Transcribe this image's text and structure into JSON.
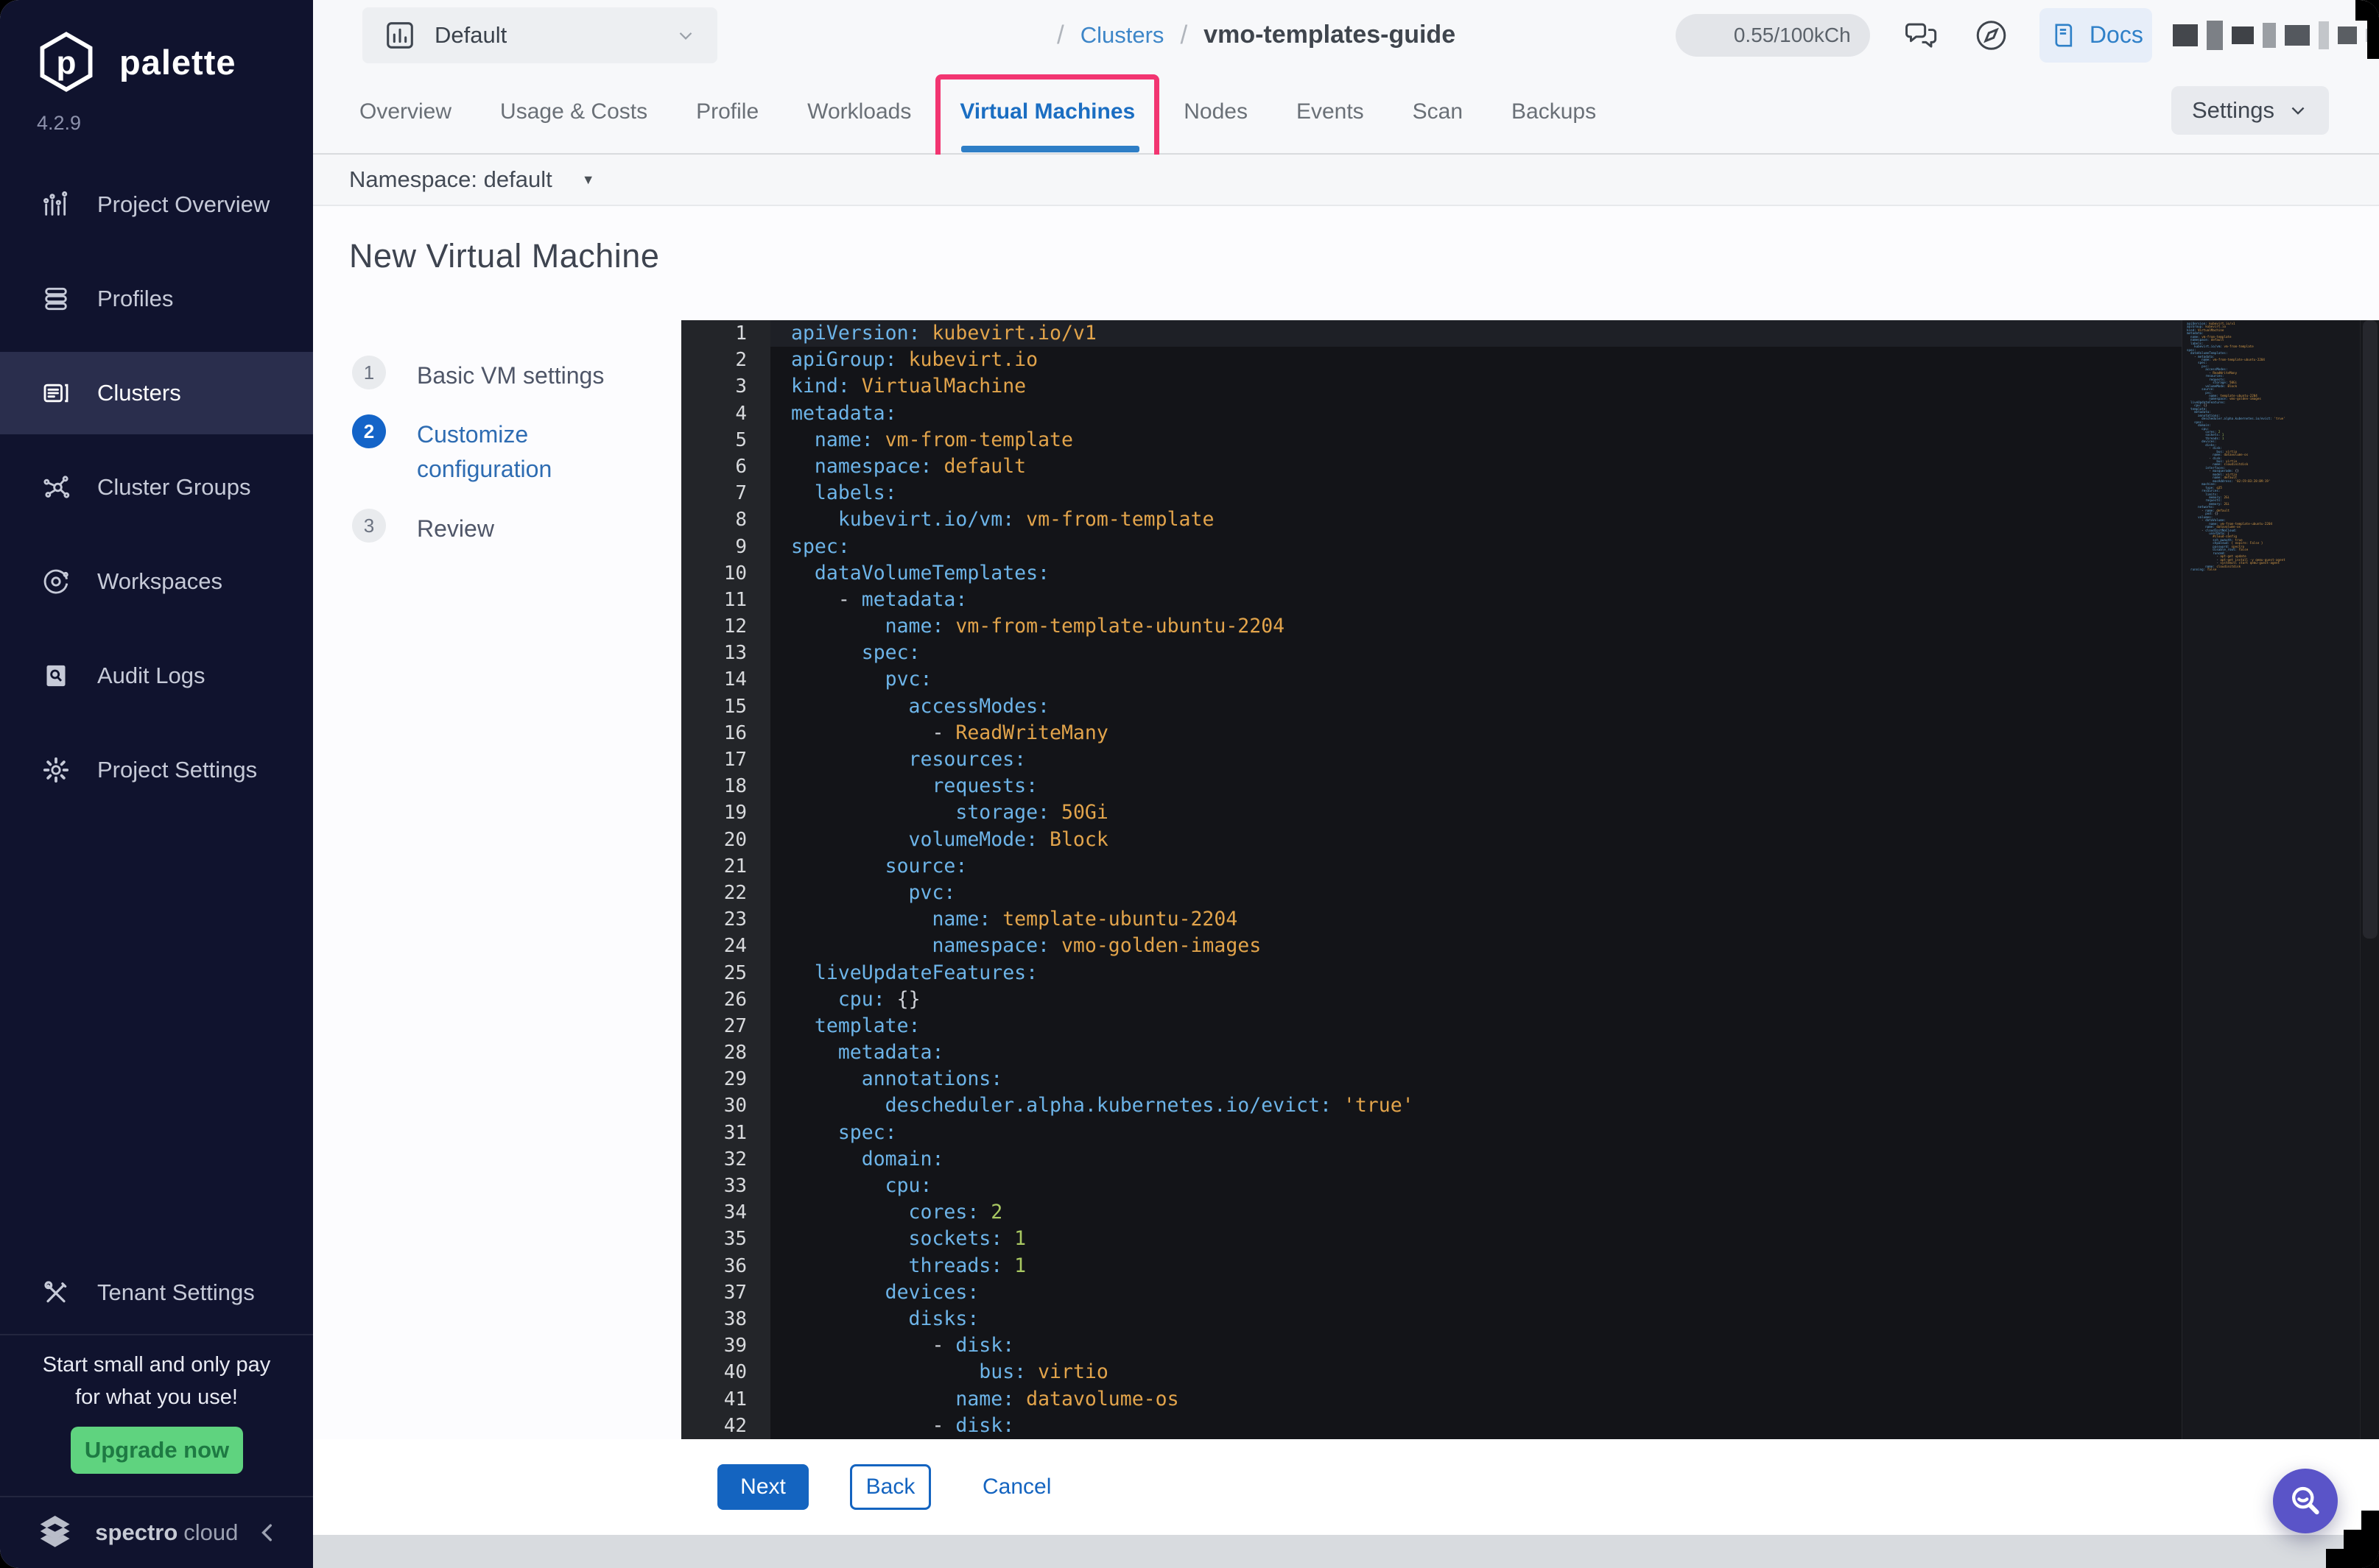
{
  "sidebar": {
    "brand": "palette",
    "version": "4.2.9",
    "items": [
      {
        "label": "Project Overview",
        "icon": "chart-icon"
      },
      {
        "label": "Profiles",
        "icon": "layers-icon"
      },
      {
        "label": "Clusters",
        "icon": "server-icon"
      },
      {
        "label": "Cluster Groups",
        "icon": "nodes-icon"
      },
      {
        "label": "Workspaces",
        "icon": "orbit-icon"
      },
      {
        "label": "Audit Logs",
        "icon": "doc-search-icon"
      },
      {
        "label": "Project Settings",
        "icon": "gear-icon"
      }
    ],
    "active_item": "Clusters",
    "active_index": 2,
    "tenant_settings_label": "Tenant Settings",
    "promo_line1": "Start small and only pay",
    "promo_line2": "for what you use!",
    "upgrade_label": "Upgrade now",
    "footer_brand_1": "spectro",
    "footer_brand_2": "cloud"
  },
  "topbar": {
    "project_selector": "Default",
    "breadcrumb": [
      "Clusters",
      "vmo-templates-guide"
    ],
    "separator": "/",
    "usage_badge": "0.55/100kCh",
    "docs_label": "Docs"
  },
  "tabs": {
    "items": [
      "Overview",
      "Usage & Costs",
      "Profile",
      "Workloads",
      "Virtual Machines",
      "Nodes",
      "Events",
      "Scan",
      "Backups"
    ],
    "active": "Virtual Machines",
    "active_index": 4,
    "settings_label": "Settings"
  },
  "toolbar": {
    "namespace_label": "Namespace: default"
  },
  "page": {
    "title": "New Virtual Machine"
  },
  "stepper": {
    "steps": [
      {
        "num": "1",
        "label": "Basic VM settings",
        "active": false
      },
      {
        "num": "2",
        "label": "Customize configuration",
        "active": true
      },
      {
        "num": "3",
        "label": "Review",
        "active": false
      }
    ]
  },
  "editor": {
    "lines": [
      "apiVersion: kubevirt.io/v1",
      "apiGroup: kubevirt.io",
      "kind: VirtualMachine",
      "metadata:",
      "  name: vm-from-template",
      "  namespace: default",
      "  labels:",
      "    kubevirt.io/vm: vm-from-template",
      "spec:",
      "  dataVolumeTemplates:",
      "    - metadata:",
      "        name: vm-from-template-ubuntu-2204",
      "      spec:",
      "        pvc:",
      "          accessModes:",
      "            - ReadWriteMany",
      "          resources:",
      "            requests:",
      "              storage: 50Gi",
      "          volumeMode: Block",
      "        source:",
      "          pvc:",
      "            name: template-ubuntu-2204",
      "            namespace: vmo-golden-images",
      "  liveUpdateFeatures:",
      "    cpu: {}",
      "  template:",
      "    metadata:",
      "      annotations:",
      "        descheduler.alpha.kubernetes.io/evict: 'true'",
      "    spec:",
      "      domain:",
      "        cpu:",
      "          cores: 2",
      "          sockets: 1",
      "          threads: 1",
      "        devices:",
      "          disks:",
      "            - disk:",
      "                bus: virtio",
      "              name: datavolume-os",
      "            - disk:"
    ],
    "minimap_continuation": [
      "                bus: virtio",
      "              name: cloudinitdisk",
      "          interfaces:",
      "            - masquerade: {}",
      "              model: virtio",
      "              name: default",
      "              macAddress: '02:C9:B3:28:B9:19'",
      "        machine:",
      "          type: q35",
      "        resources:",
      "          limits:",
      "            memory: 2Gi",
      "          requests:",
      "            memory: 2Gi",
      "      networks:",
      "        - name: default",
      "          pod: {}",
      "      volumes:",
      "        - dataVolume:",
      "            name: vm-from-template-ubuntu-2204",
      "          name: datavolume-os",
      "        - cloudInitNoCloud:",
      "            userData: |",
      "              #cloud-config",
      "              ssh_pwauth: true",
      "              chpasswd: { expire: False }",
      "              password: spectro",
      "              disable_root: false",
      "              runcmd:",
      "                - apt-get update",
      "                - apt-get install -y qemu-guest-agent",
      "                - systemctl start qemu-guest-agent",
      "          name: cloudinitdisk",
      "  running: false"
    ]
  },
  "actions": {
    "next": "Next",
    "back": "Back",
    "cancel": "Cancel"
  },
  "colors": {
    "accent_blue": "#1464c8",
    "annotation_pink": "#f23571",
    "upgrade_green": "#5fd37f",
    "sidebar_bg": "#10132e",
    "editor_bg": "#131418",
    "code_key": "#6db4e8",
    "code_value": "#e2a44b",
    "code_number": "#a9c862"
  }
}
